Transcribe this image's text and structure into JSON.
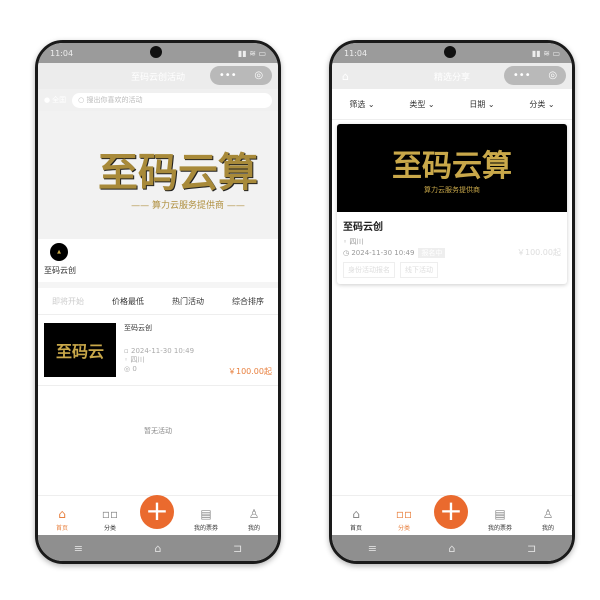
{
  "status": {
    "time": "11:04"
  },
  "left": {
    "title": "至码云创活动",
    "location": "全国",
    "search_placeholder": "搜出你喜欢的活动",
    "banner_text": "至码云算",
    "banner_sub": "—— 算力云服务提供商 ——",
    "org_name": "至码云创",
    "sort_tabs": [
      "即将开始",
      "价格最低",
      "热门活动",
      "综合排序"
    ],
    "item": {
      "thumb_text": "至码云",
      "title": "至码云创",
      "date": "2024-11-30 10:49",
      "location": "四川",
      "views": "0",
      "price": "￥100.00起"
    },
    "empty": "暂无活动"
  },
  "right": {
    "title": "精选分享",
    "filters": [
      "筛选",
      "类型",
      "日期",
      "分类"
    ],
    "card": {
      "image_text": "至码云算",
      "image_sub": "算力云服务提供商",
      "title": "至码云创",
      "location": "四川",
      "date": "2024-11-30 10:49",
      "badge": "报名中",
      "price": "￥100.00起",
      "tags": [
        "身份活动报名",
        "线下活动"
      ]
    }
  },
  "tabbar": [
    {
      "label": "首页",
      "icon": "home-icon"
    },
    {
      "label": "分类",
      "icon": "grid-icon"
    },
    {
      "label": "我的票券",
      "icon": "ticket-icon"
    },
    {
      "label": "我的",
      "icon": "user-icon"
    }
  ],
  "accent": "#ea6a2e"
}
